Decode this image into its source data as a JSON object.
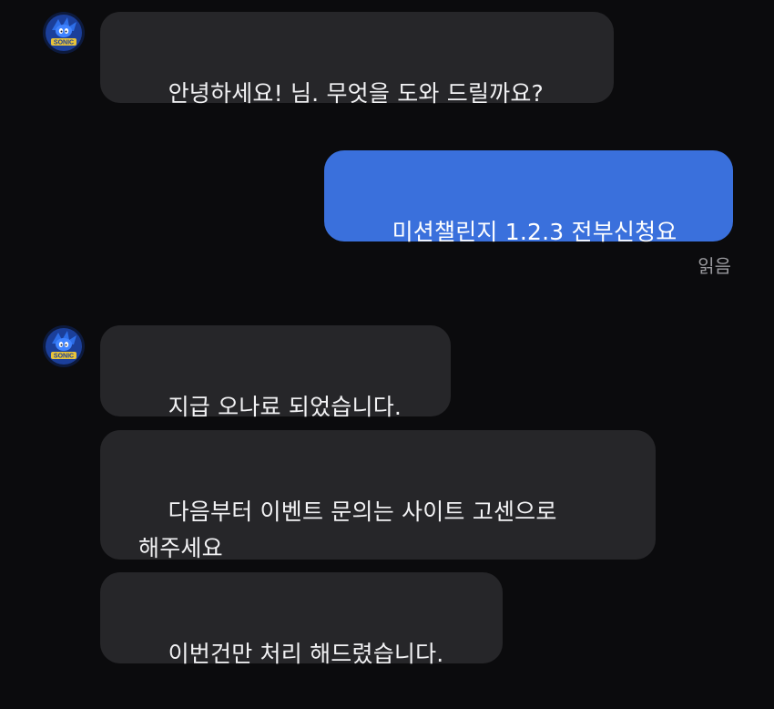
{
  "conversation": {
    "messages": [
      {
        "id": "m1",
        "direction": "incoming",
        "text": "안녕하세요! 님. 무엇을 도와 드릴까요?"
      },
      {
        "id": "m2",
        "direction": "outgoing",
        "text": "미션챌린지 1.2.3 전부신청요",
        "status": "읽음"
      },
      {
        "id": "m3",
        "direction": "incoming",
        "text": "지급 오나료 되었습니다."
      },
      {
        "id": "m4",
        "direction": "incoming",
        "text": "다음부터 이벤트 문의는 사이트 고센으로\n해주세요"
      },
      {
        "id": "m5",
        "direction": "incoming",
        "text": "이번건만 처리 해드렸습니다."
      }
    ]
  },
  "avatar": {
    "icon": "sonic-avatar-icon",
    "badge_text": "SONIC"
  },
  "colors": {
    "background": "#0b0b0d",
    "incoming_bubble": "#262629",
    "outgoing_bubble": "#3a70dc",
    "text": "#f2f2f4",
    "receipt": "#9a9a9e"
  }
}
